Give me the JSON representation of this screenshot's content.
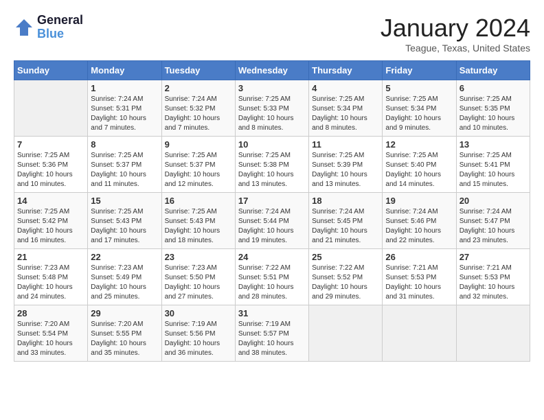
{
  "header": {
    "logo_line1": "General",
    "logo_line2": "Blue",
    "month": "January 2024",
    "location": "Teague, Texas, United States"
  },
  "weekdays": [
    "Sunday",
    "Monday",
    "Tuesday",
    "Wednesday",
    "Thursday",
    "Friday",
    "Saturday"
  ],
  "weeks": [
    [
      {
        "day": "",
        "sunrise": "",
        "sunset": "",
        "daylight": ""
      },
      {
        "day": "1",
        "sunrise": "Sunrise: 7:24 AM",
        "sunset": "Sunset: 5:31 PM",
        "daylight": "Daylight: 10 hours and 7 minutes."
      },
      {
        "day": "2",
        "sunrise": "Sunrise: 7:24 AM",
        "sunset": "Sunset: 5:32 PM",
        "daylight": "Daylight: 10 hours and 7 minutes."
      },
      {
        "day": "3",
        "sunrise": "Sunrise: 7:25 AM",
        "sunset": "Sunset: 5:33 PM",
        "daylight": "Daylight: 10 hours and 8 minutes."
      },
      {
        "day": "4",
        "sunrise": "Sunrise: 7:25 AM",
        "sunset": "Sunset: 5:34 PM",
        "daylight": "Daylight: 10 hours and 8 minutes."
      },
      {
        "day": "5",
        "sunrise": "Sunrise: 7:25 AM",
        "sunset": "Sunset: 5:34 PM",
        "daylight": "Daylight: 10 hours and 9 minutes."
      },
      {
        "day": "6",
        "sunrise": "Sunrise: 7:25 AM",
        "sunset": "Sunset: 5:35 PM",
        "daylight": "Daylight: 10 hours and 10 minutes."
      }
    ],
    [
      {
        "day": "7",
        "sunrise": "Sunrise: 7:25 AM",
        "sunset": "Sunset: 5:36 PM",
        "daylight": "Daylight: 10 hours and 10 minutes."
      },
      {
        "day": "8",
        "sunrise": "Sunrise: 7:25 AM",
        "sunset": "Sunset: 5:37 PM",
        "daylight": "Daylight: 10 hours and 11 minutes."
      },
      {
        "day": "9",
        "sunrise": "Sunrise: 7:25 AM",
        "sunset": "Sunset: 5:37 PM",
        "daylight": "Daylight: 10 hours and 12 minutes."
      },
      {
        "day": "10",
        "sunrise": "Sunrise: 7:25 AM",
        "sunset": "Sunset: 5:38 PM",
        "daylight": "Daylight: 10 hours and 13 minutes."
      },
      {
        "day": "11",
        "sunrise": "Sunrise: 7:25 AM",
        "sunset": "Sunset: 5:39 PM",
        "daylight": "Daylight: 10 hours and 13 minutes."
      },
      {
        "day": "12",
        "sunrise": "Sunrise: 7:25 AM",
        "sunset": "Sunset: 5:40 PM",
        "daylight": "Daylight: 10 hours and 14 minutes."
      },
      {
        "day": "13",
        "sunrise": "Sunrise: 7:25 AM",
        "sunset": "Sunset: 5:41 PM",
        "daylight": "Daylight: 10 hours and 15 minutes."
      }
    ],
    [
      {
        "day": "14",
        "sunrise": "Sunrise: 7:25 AM",
        "sunset": "Sunset: 5:42 PM",
        "daylight": "Daylight: 10 hours and 16 minutes."
      },
      {
        "day": "15",
        "sunrise": "Sunrise: 7:25 AM",
        "sunset": "Sunset: 5:43 PM",
        "daylight": "Daylight: 10 hours and 17 minutes."
      },
      {
        "day": "16",
        "sunrise": "Sunrise: 7:25 AM",
        "sunset": "Sunset: 5:43 PM",
        "daylight": "Daylight: 10 hours and 18 minutes."
      },
      {
        "day": "17",
        "sunrise": "Sunrise: 7:24 AM",
        "sunset": "Sunset: 5:44 PM",
        "daylight": "Daylight: 10 hours and 19 minutes."
      },
      {
        "day": "18",
        "sunrise": "Sunrise: 7:24 AM",
        "sunset": "Sunset: 5:45 PM",
        "daylight": "Daylight: 10 hours and 21 minutes."
      },
      {
        "day": "19",
        "sunrise": "Sunrise: 7:24 AM",
        "sunset": "Sunset: 5:46 PM",
        "daylight": "Daylight: 10 hours and 22 minutes."
      },
      {
        "day": "20",
        "sunrise": "Sunrise: 7:24 AM",
        "sunset": "Sunset: 5:47 PM",
        "daylight": "Daylight: 10 hours and 23 minutes."
      }
    ],
    [
      {
        "day": "21",
        "sunrise": "Sunrise: 7:23 AM",
        "sunset": "Sunset: 5:48 PM",
        "daylight": "Daylight: 10 hours and 24 minutes."
      },
      {
        "day": "22",
        "sunrise": "Sunrise: 7:23 AM",
        "sunset": "Sunset: 5:49 PM",
        "daylight": "Daylight: 10 hours and 25 minutes."
      },
      {
        "day": "23",
        "sunrise": "Sunrise: 7:23 AM",
        "sunset": "Sunset: 5:50 PM",
        "daylight": "Daylight: 10 hours and 27 minutes."
      },
      {
        "day": "24",
        "sunrise": "Sunrise: 7:22 AM",
        "sunset": "Sunset: 5:51 PM",
        "daylight": "Daylight: 10 hours and 28 minutes."
      },
      {
        "day": "25",
        "sunrise": "Sunrise: 7:22 AM",
        "sunset": "Sunset: 5:52 PM",
        "daylight": "Daylight: 10 hours and 29 minutes."
      },
      {
        "day": "26",
        "sunrise": "Sunrise: 7:21 AM",
        "sunset": "Sunset: 5:53 PM",
        "daylight": "Daylight: 10 hours and 31 minutes."
      },
      {
        "day": "27",
        "sunrise": "Sunrise: 7:21 AM",
        "sunset": "Sunset: 5:53 PM",
        "daylight": "Daylight: 10 hours and 32 minutes."
      }
    ],
    [
      {
        "day": "28",
        "sunrise": "Sunrise: 7:20 AM",
        "sunset": "Sunset: 5:54 PM",
        "daylight": "Daylight: 10 hours and 33 minutes."
      },
      {
        "day": "29",
        "sunrise": "Sunrise: 7:20 AM",
        "sunset": "Sunset: 5:55 PM",
        "daylight": "Daylight: 10 hours and 35 minutes."
      },
      {
        "day": "30",
        "sunrise": "Sunrise: 7:19 AM",
        "sunset": "Sunset: 5:56 PM",
        "daylight": "Daylight: 10 hours and 36 minutes."
      },
      {
        "day": "31",
        "sunrise": "Sunrise: 7:19 AM",
        "sunset": "Sunset: 5:57 PM",
        "daylight": "Daylight: 10 hours and 38 minutes."
      },
      {
        "day": "",
        "sunrise": "",
        "sunset": "",
        "daylight": ""
      },
      {
        "day": "",
        "sunrise": "",
        "sunset": "",
        "daylight": ""
      },
      {
        "day": "",
        "sunrise": "",
        "sunset": "",
        "daylight": ""
      }
    ]
  ],
  "colors": {
    "header_bg": "#4a7cc7",
    "header_text": "#ffffff",
    "odd_row": "#f9f9f9",
    "even_row": "#ffffff",
    "empty_cell": "#f0f0f0"
  }
}
